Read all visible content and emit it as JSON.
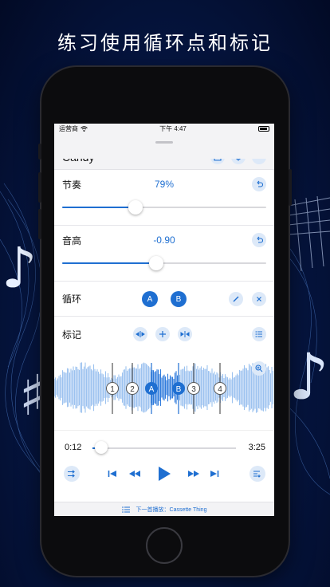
{
  "headline": "练习使用循环点和标记",
  "status_bar": {
    "carrier": "运营商",
    "time": "下午 4:47"
  },
  "nav": {
    "title": "Candy",
    "icons": [
      "download-icon",
      "gear-icon",
      "more-icon"
    ]
  },
  "tempo": {
    "label": "节奏",
    "value": "79%",
    "level": 0.36
  },
  "pitch": {
    "label": "音高",
    "value": "-0.90",
    "level": 0.46
  },
  "loop": {
    "label": "循环",
    "point_a": "A",
    "point_b": "B"
  },
  "markers": {
    "label": "标记",
    "items": [
      "1",
      "2",
      "3",
      "4"
    ],
    "loop_a": "A",
    "loop_b": "B"
  },
  "player": {
    "elapsed": "0:12",
    "duration": "3:25",
    "progress": 0.06
  },
  "up_next": {
    "text": "下一首播放：Cassette Thing"
  },
  "colors": {
    "accent": "#1f6fd1",
    "background": "#061847"
  }
}
